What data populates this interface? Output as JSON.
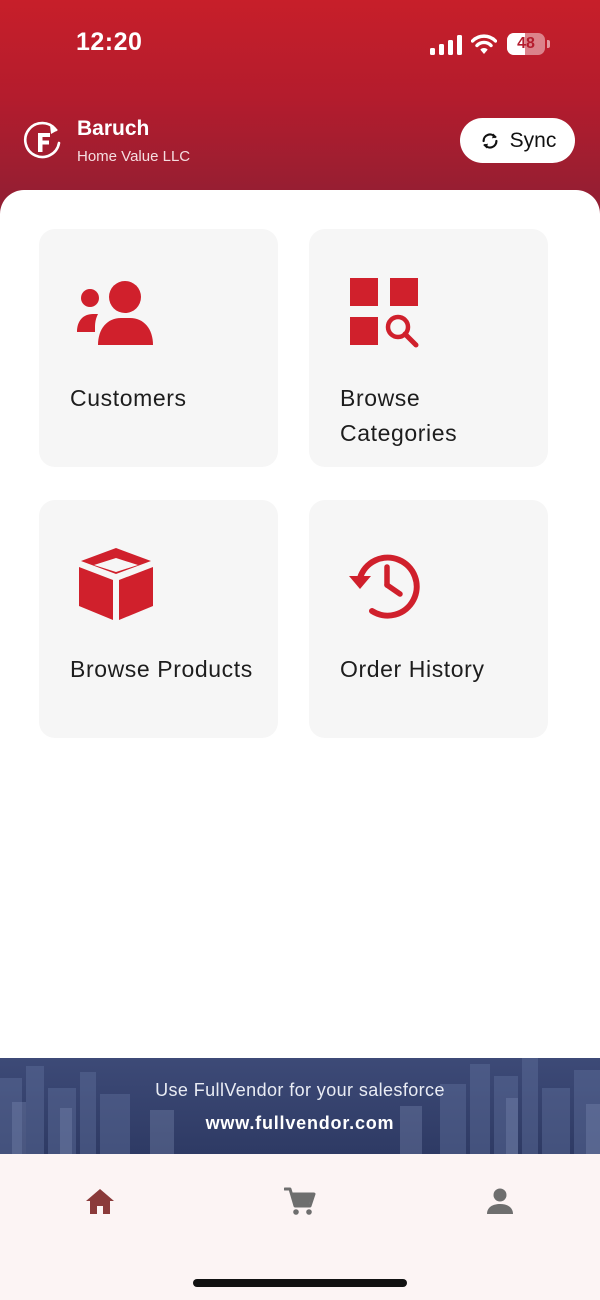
{
  "status_bar": {
    "time": "12:20",
    "battery_level": "48",
    "battery_fraction": 0.48,
    "icons": [
      "signal-icon",
      "wifi-icon",
      "battery-icon"
    ]
  },
  "header": {
    "logo_icon": "fullvendor-logo-icon",
    "user_name": "Baruch",
    "company_name": "Home Value LLC",
    "sync_label": "Sync",
    "sync_icon": "sync-icon"
  },
  "tiles": [
    {
      "label": "Customers",
      "icon": "customers-icon"
    },
    {
      "label": "Browse Categories",
      "icon": "categories-search-icon"
    },
    {
      "label": "Browse Products",
      "icon": "box-icon"
    },
    {
      "label": "Order History",
      "icon": "history-icon"
    }
  ],
  "banner": {
    "tagline": "Use FullVendor for your salesforce",
    "url": "www.fullvendor.com"
  },
  "tab_bar": {
    "items": [
      {
        "name": "home",
        "icon": "home-icon",
        "active": true
      },
      {
        "name": "cart",
        "icon": "cart-icon",
        "active": false
      },
      {
        "name": "profile",
        "icon": "person-icon",
        "active": false
      }
    ]
  },
  "colors": {
    "brand_red": "#c71f2a",
    "header_gradient_end": "#8f1f33",
    "tile_background": "#f6f6f6",
    "banner_navy": "#2e3a64",
    "tab_bar_background": "#fcf4f4",
    "active_tab": "#8b3a3a",
    "inactive_tab": "#6e6e6e"
  }
}
